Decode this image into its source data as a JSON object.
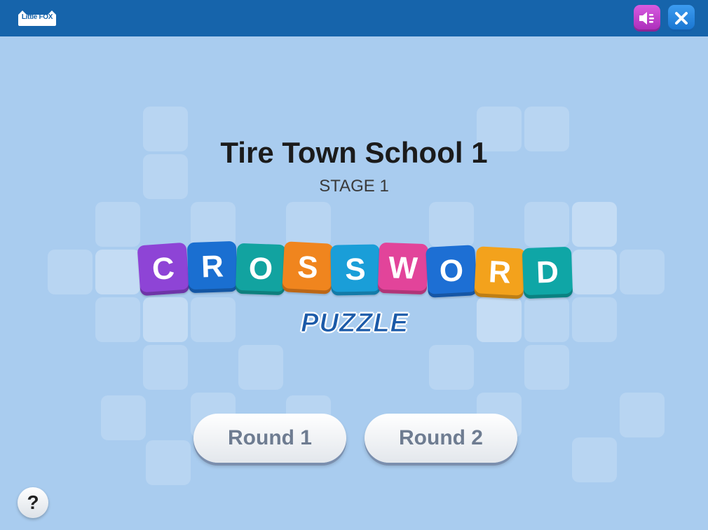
{
  "header": {
    "logo_text": "Little FOX",
    "sound_icon": "speaker-icon",
    "close_icon": "close-icon"
  },
  "main": {
    "title": "Tire Town School 1",
    "stage": "STAGE 1",
    "logo_letters": [
      "C",
      "R",
      "O",
      "S",
      "S",
      "W",
      "O",
      "R",
      "D"
    ],
    "logo_colors": [
      "#8e44d6",
      "#1a6fd1",
      "#12a3a0",
      "#f0851e",
      "#1a9ed8",
      "#e2449a",
      "#1d6fd4",
      "#f3a21c",
      "#0fa6a6"
    ],
    "logo_subtitle": "PUZZLE",
    "rounds": [
      {
        "label": "Round 1"
      },
      {
        "label": "Round 2"
      }
    ]
  },
  "footer": {
    "help_label": "?"
  },
  "colors": {
    "topbar": "#1664ab",
    "background": "#a9ccef",
    "sound_button": "#c045cf",
    "close_button": "#2a88e3"
  }
}
